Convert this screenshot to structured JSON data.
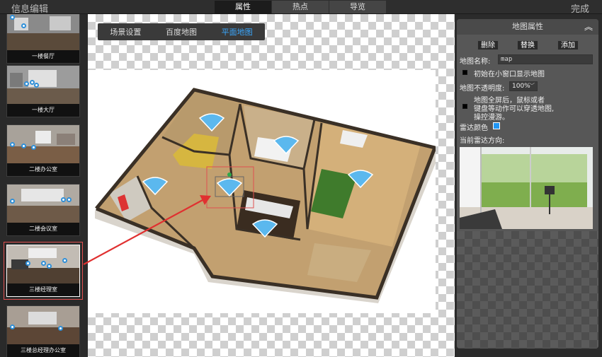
{
  "header": {
    "title": "信息编辑",
    "done_label": "完成",
    "tabs": [
      {
        "label": "属性",
        "active": true
      },
      {
        "label": "热点",
        "active": false
      },
      {
        "label": "导览",
        "active": false
      }
    ]
  },
  "sidebar": {
    "scenes": [
      {
        "label": "一楼餐厅"
      },
      {
        "label": "一楼大厅"
      },
      {
        "label": "二楼办公室"
      },
      {
        "label": "二楼会议室"
      },
      {
        "label": "三楼经理室",
        "selected": true
      },
      {
        "label": "三楼总经理办公室"
      }
    ]
  },
  "canvas": {
    "subtabs": [
      {
        "label": "场景设置"
      },
      {
        "label": "百度地图"
      },
      {
        "label": "平面地图",
        "active": true
      }
    ]
  },
  "panel": {
    "title": "地图属性",
    "buttons": {
      "delete": "删除",
      "replace": "替换",
      "add": "添加"
    },
    "name_label": "地图名称:",
    "name_value": "map",
    "show_small_label": "初始在小窗口显示地图",
    "opacity_label": "地图不透明度:",
    "opacity_value": "100%",
    "fullscreen_note_1": "地图全屏后，鼠标或者",
    "fullscreen_note_2": "键盘等动作可以穿透地图,",
    "fullscreen_note_3": "操控漫游。",
    "radar_color_label": "雷达颜色",
    "radar_direction_label": "当前雷达方向:"
  },
  "colors": {
    "accent": "#3aa8ff",
    "radar": "#2196f3",
    "selection": "#e05050"
  }
}
